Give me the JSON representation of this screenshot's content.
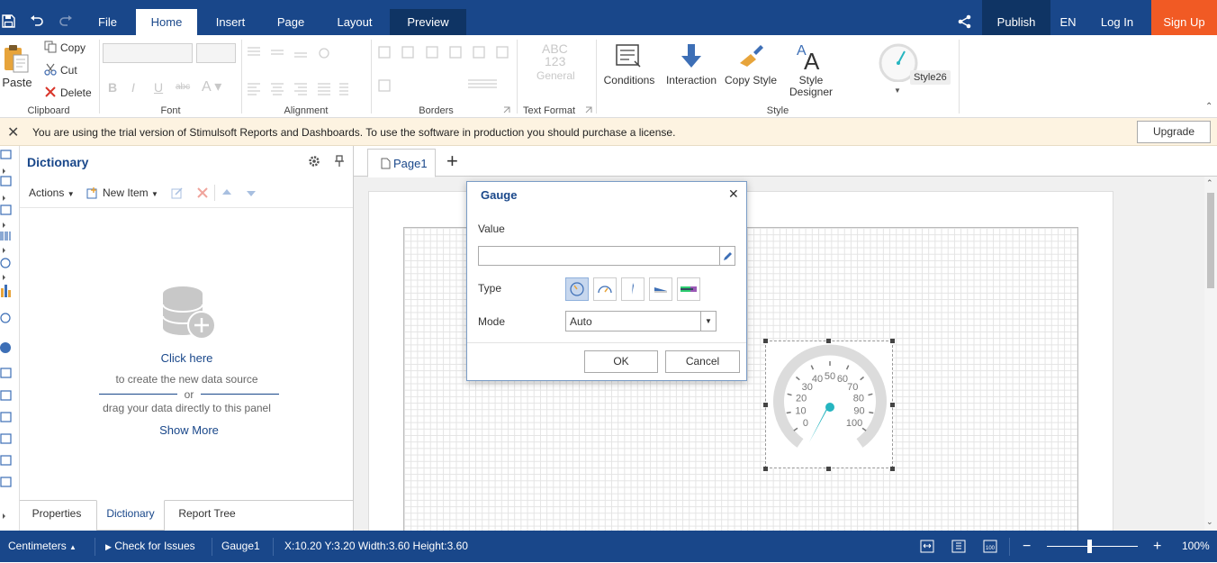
{
  "topbar": {
    "tabs": [
      "File",
      "Home",
      "Insert",
      "Page",
      "Layout",
      "Preview"
    ],
    "active_tab": "Home",
    "publish": "Publish",
    "language": "EN",
    "login": "Log In",
    "signup": "Sign Up"
  },
  "ribbon": {
    "clipboard": {
      "label": "Clipboard",
      "paste": "Paste",
      "copy": "Copy",
      "cut": "Cut",
      "delete": "Delete"
    },
    "font": {
      "label": "Font"
    },
    "alignment": {
      "label": "Alignment"
    },
    "borders": {
      "label": "Borders"
    },
    "text_format": {
      "label": "Text Format",
      "abc": "ABC",
      "num": "123",
      "general": "General"
    },
    "style": {
      "label": "Style",
      "conditions": "Conditions",
      "interaction": "Interaction",
      "copy_style": "Copy Style",
      "style_designer_1": "Style",
      "style_designer_2": "Designer",
      "style_name": "Style26"
    }
  },
  "notice": {
    "text": "You are using the trial version of Stimulsoft Reports and Dashboards. To use the software in production you should purchase a license.",
    "upgrade": "Upgrade"
  },
  "dictionary": {
    "title": "Dictionary",
    "actions": "Actions",
    "new_item": "New Item",
    "click_here": "Click here",
    "create_text": "to create the new data source",
    "or": "or",
    "drag_text": "drag your data directly to this panel",
    "show_more": "Show More"
  },
  "panel_tabs": [
    "Properties",
    "Dictionary",
    "Report Tree"
  ],
  "page_tab": "Page1",
  "dialog": {
    "title": "Gauge",
    "value_label": "Value",
    "value": "",
    "type_label": "Type",
    "mode_label": "Mode",
    "mode_value": "Auto",
    "ok": "OK",
    "cancel": "Cancel"
  },
  "gauge": {
    "ticks": [
      "0",
      "10",
      "20",
      "30",
      "40",
      "50",
      "60",
      "70",
      "80",
      "90",
      "100"
    ],
    "accent": "#26b5c0"
  },
  "status": {
    "units": "Centimeters",
    "check": "Check for Issues",
    "component": "Gauge1",
    "coords": "X:10.20 Y:3.20 Width:3.60 Height:3.60",
    "zoom": "100%"
  },
  "colors": {
    "brand": "#19478a",
    "signup": "#f15a24",
    "preview_tab": "#0f3464"
  }
}
